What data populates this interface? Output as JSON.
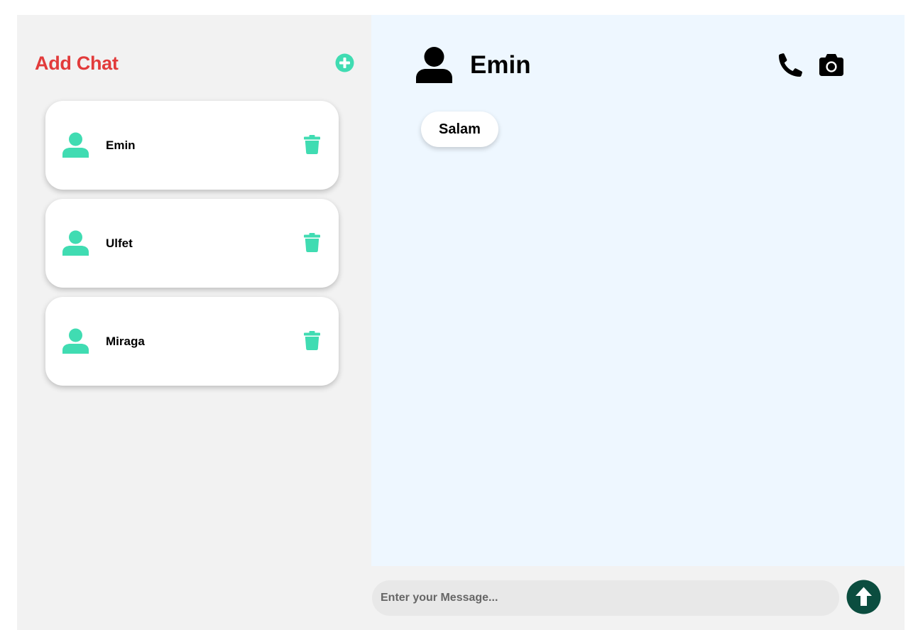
{
  "colors": {
    "accent": "#40dcb2",
    "title_red": "#e23b3b",
    "send_dark": "#0b4d3f",
    "conversation_bg": "#eef7ff",
    "sidebar_bg": "#f2f2f2",
    "input_bg": "#e8e8e8"
  },
  "sidebar": {
    "title": "Add Chat",
    "add_icon": "plus-circle-icon",
    "chats": [
      {
        "name": "Emin",
        "avatar_icon": "user-icon",
        "delete_icon": "trash-icon"
      },
      {
        "name": "Ulfet",
        "avatar_icon": "user-icon",
        "delete_icon": "trash-icon"
      },
      {
        "name": "Miraga",
        "avatar_icon": "user-icon",
        "delete_icon": "trash-icon"
      }
    ]
  },
  "conversation": {
    "contact_name": "Emin",
    "avatar_icon": "user-icon",
    "call_icon": "phone-icon",
    "camera_icon": "camera-icon",
    "messages": [
      {
        "text": "Salam"
      }
    ]
  },
  "composer": {
    "placeholder": "Enter your Message...",
    "value": "",
    "send_icon": "arrow-up-circle-icon"
  }
}
